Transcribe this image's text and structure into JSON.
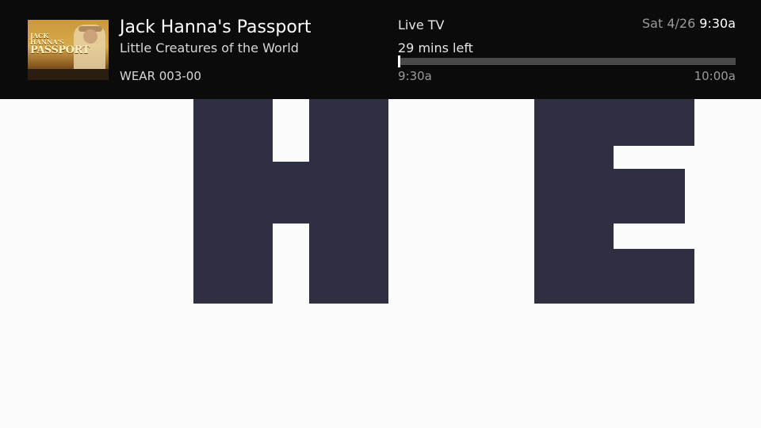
{
  "program": {
    "title": "Jack Hanna's Passport",
    "episode": "Little Creatures of the World",
    "channel": "WEAR 003-00",
    "thumbnail_logo_line1": "JACK HANNA'S",
    "thumbnail_logo_line2": "PASSPORT"
  },
  "playback": {
    "source": "Live TV",
    "remaining": "29 mins left",
    "start_time": "9:30a",
    "end_time": "10:00a",
    "progress_fraction": 0.0
  },
  "clock": {
    "date": "Sat 4/26",
    "time": "9:30a"
  },
  "colors": {
    "banner_background": "#0b0b0b",
    "video_background": "#fbfbfb",
    "letters": "#2e2f40"
  }
}
